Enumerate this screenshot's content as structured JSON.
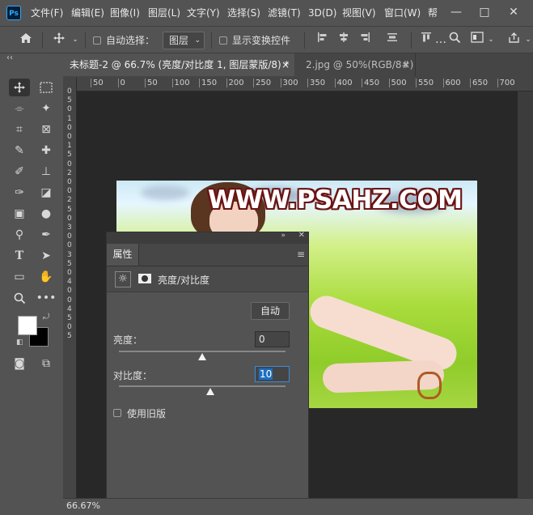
{
  "app": {
    "logo": "Ps"
  },
  "menu": [
    "文件(F)",
    "编辑(E)",
    "图像(I)",
    "图层(L)",
    "文字(Y)",
    "选择(S)",
    "滤镜(T)",
    "3D(D)",
    "视图(V)",
    "窗口(W)",
    "帮"
  ],
  "window_controls": {
    "minimize": "—",
    "maximize": "□",
    "close": "✕"
  },
  "options": {
    "auto_select_label": "自动选择：",
    "auto_select_value": "图层",
    "show_transform_label": "显示变换控件"
  },
  "tabs": [
    {
      "label": "未标题-2 @ 66.7% (亮度/对比度 1, 图层蒙版/8) *",
      "close": "×"
    },
    {
      "label": "2.jpg @ 50%(RGB/8#)",
      "close": "×"
    }
  ],
  "ruler_top": [
    "50",
    "0",
    "50",
    "100",
    "150",
    "200",
    "250",
    "300",
    "350",
    "400",
    "450",
    "500",
    "550",
    "600",
    "650",
    "700"
  ],
  "ruler_left": [
    "0",
    "5",
    "0",
    "1",
    "0",
    "0",
    "1",
    "5",
    "0",
    "2",
    "0",
    "0",
    "2",
    "5",
    "0",
    "3",
    "0",
    "0",
    "3",
    "5",
    "0",
    "4",
    "0",
    "0",
    "4",
    "5",
    "0",
    "5"
  ],
  "document": {
    "watermark": "WWW.PSAHZ.COM"
  },
  "properties": {
    "tab_label": "属性",
    "adjustment_name": "亮度/对比度",
    "auto_label": "自动",
    "brightness_label": "亮度：",
    "brightness_value": "0",
    "brightness_slider": 0.5,
    "contrast_label": "对比度：",
    "contrast_value": "10",
    "contrast_slider": 0.55,
    "legacy_label": "使用旧版"
  },
  "status": {
    "zoom": "66.67%"
  },
  "colors": {
    "foreground": "#ffffff",
    "background": "#000000",
    "accent": "#31a8ff"
  }
}
